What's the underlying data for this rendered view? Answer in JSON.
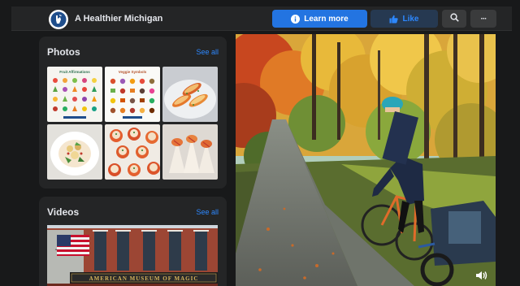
{
  "page": {
    "name": "A Healthier Michigan"
  },
  "header": {
    "learn_more_label": "Learn more",
    "like_label": "Like",
    "more_label": "···"
  },
  "photos": {
    "title": "Photos",
    "see_all": "See all",
    "items": [
      {
        "name": "produce-infographic",
        "caption": "Fruit Affirmations"
      },
      {
        "name": "vegetable-infographic",
        "caption": "Veggie Symbols"
      },
      {
        "name": "stuffed-peppers"
      },
      {
        "name": "salad-plate"
      },
      {
        "name": "tomato-bites"
      },
      {
        "name": "wrap-rolls"
      }
    ]
  },
  "videos": {
    "title": "Videos",
    "see_all": "See all",
    "sign_text": "AMERICAN MUSEUM OF MAGIC"
  },
  "colors": {
    "background": "#18191a",
    "card": "#242526",
    "accent": "#2374e1",
    "link": "#2d88ff",
    "text": "#e4e6eb"
  }
}
